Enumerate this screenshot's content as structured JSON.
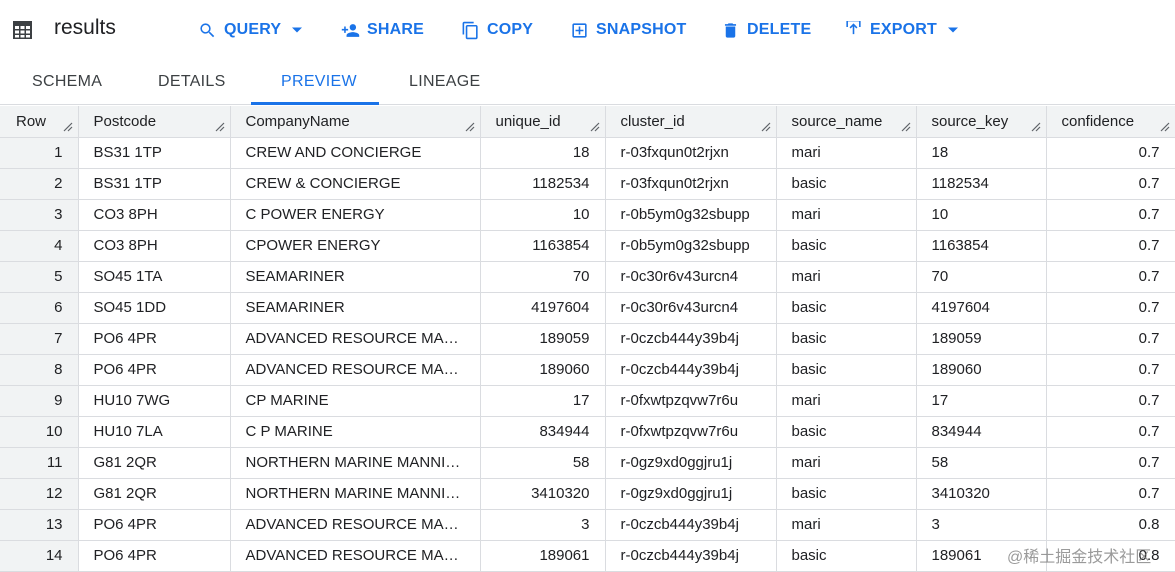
{
  "header": {
    "title": "results",
    "actions": {
      "query": "QUERY",
      "share": "SHARE",
      "copy": "COPY",
      "snapshot": "SNAPSHOT",
      "delete": "DELETE",
      "export": "EXPORT"
    }
  },
  "tabs": {
    "schema": "SCHEMA",
    "details": "DETAILS",
    "preview": "PREVIEW",
    "lineage": "LINEAGE"
  },
  "table": {
    "columns": [
      "Row",
      "Postcode",
      "CompanyName",
      "unique_id",
      "cluster_id",
      "source_name",
      "source_key",
      "confidence"
    ],
    "rows": [
      [
        "1",
        "BS31 1TP",
        "CREW AND CONCIERGE",
        "18",
        "r-03fxqun0t2rjxn",
        "mari",
        "18",
        "0.7"
      ],
      [
        "2",
        "BS31 1TP",
        "CREW & CONCIERGE",
        "1182534",
        "r-03fxqun0t2rjxn",
        "basic",
        "1182534",
        "0.7"
      ],
      [
        "3",
        "CO3 8PH",
        "C POWER ENERGY",
        "10",
        "r-0b5ym0g32sbupp",
        "mari",
        "10",
        "0.7"
      ],
      [
        "4",
        "CO3 8PH",
        "CPOWER ENERGY",
        "1163854",
        "r-0b5ym0g32sbupp",
        "basic",
        "1163854",
        "0.7"
      ],
      [
        "5",
        "SO45 1TA",
        "SEAMARINER",
        "70",
        "r-0c30r6v43urcn4",
        "mari",
        "70",
        "0.7"
      ],
      [
        "6",
        "SO45 1DD",
        "SEAMARINER",
        "4197604",
        "r-0c30r6v43urcn4",
        "basic",
        "4197604",
        "0.7"
      ],
      [
        "7",
        "PO6 4PR",
        "ADVANCED RESOURCE MANA…",
        "189059",
        "r-0czcb444y39b4j",
        "basic",
        "189059",
        "0.7"
      ],
      [
        "8",
        "PO6 4PR",
        "ADVANCED RESOURCE MANA…",
        "189060",
        "r-0czcb444y39b4j",
        "basic",
        "189060",
        "0.7"
      ],
      [
        "9",
        "HU10 7WG",
        "CP MARINE",
        "17",
        "r-0fxwtpzqvw7r6u",
        "mari",
        "17",
        "0.7"
      ],
      [
        "10",
        "HU10 7LA",
        "C P MARINE",
        "834944",
        "r-0fxwtpzqvw7r6u",
        "basic",
        "834944",
        "0.7"
      ],
      [
        "11",
        "G81 2QR",
        "NORTHERN MARINE MANNIN…",
        "58",
        "r-0gz9xd0ggjru1j",
        "mari",
        "58",
        "0.7"
      ],
      [
        "12",
        "G81 2QR",
        "NORTHERN MARINE MANNING",
        "3410320",
        "r-0gz9xd0ggjru1j",
        "basic",
        "3410320",
        "0.7"
      ],
      [
        "13",
        "PO6 4PR",
        "ADVANCED RESOURCE MANA…",
        "3",
        "r-0czcb444y39b4j",
        "mari",
        "3",
        "0.8"
      ],
      [
        "14",
        "PO6 4PR",
        "ADVANCED RESOURCE MANA…",
        "189061",
        "r-0czcb444y39b4j",
        "basic",
        "189061",
        "0.8"
      ]
    ]
  },
  "watermark": "@稀土掘金技术社区",
  "colors": {
    "accent": "#1a73e8",
    "header_bg": "#f1f3f4",
    "border": "#dadce0"
  },
  "icons": [
    "table-icon",
    "search-icon",
    "share-user-icon",
    "copy-icon",
    "snapshot-icon",
    "delete-icon",
    "export-icon",
    "caret-down-icon",
    "resize-grip-icon"
  ]
}
